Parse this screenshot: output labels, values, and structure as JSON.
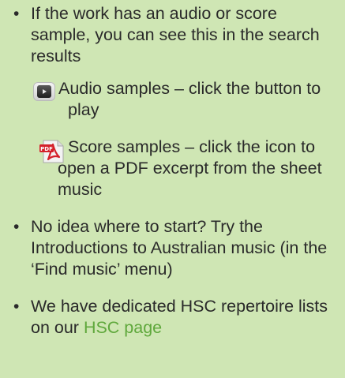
{
  "bullets": [
    {
      "text": "If the work has an audio or score sample, you can see this in the search results"
    },
    {
      "text": "No idea where to start? Try the Introductions to Australian music (in the ‘Find music’ menu)"
    },
    {
      "text_before": "We have dedicated HSC repertoire lists on our ",
      "link_text": "HSC page"
    }
  ],
  "samples": {
    "audio": {
      "icon": "audio-play-button-icon",
      "text": "Audio samples – click the button to play"
    },
    "score": {
      "icon": "pdf-file-icon",
      "text": "Score samples – click the icon to open a PDF excerpt from the sheet music"
    }
  },
  "colors": {
    "background": "#cfe6b4",
    "text": "#2a2a2a",
    "link": "#5fa83c",
    "pdf_red": "#d4202a"
  }
}
